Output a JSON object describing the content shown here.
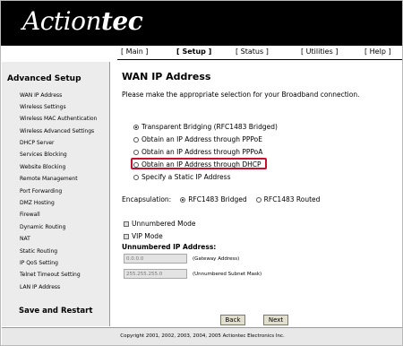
{
  "brand": {
    "logo_main": "Action",
    "logo_tec": "tec"
  },
  "nav": {
    "main": "[ Main ]",
    "setup": "[ Setup ]",
    "status": "[ Status ]",
    "utilities": "[ Utilities ]",
    "help": "[ Help ]"
  },
  "sidebar": {
    "title": "Advanced Setup",
    "items": [
      "WAN IP Address",
      "Wireless Settings",
      "Wireless MAC Authentication",
      "Wireless Advanced Settings",
      "DHCP Server",
      "Services Blocking",
      "Website Blocking",
      "Remote Management",
      "Port Forwarding",
      "DMZ Hosting",
      "Firewall",
      "Dynamic Routing",
      "NAT",
      "Static Routing",
      "IP QoS Setting",
      "Telnet Timeout Setting",
      "LAN IP Address"
    ],
    "save": "Save and Restart"
  },
  "main": {
    "title": "WAN IP Address",
    "intro": "Please make the appropriate selection for your Broadband connection.",
    "options": [
      "Transparent Bridging (RFC1483 Bridged)",
      "Obtain an IP Address through PPPoE",
      "Obtain an IP Address through PPPoA",
      "Obtain an IP Address through DHCP",
      "Specify a Static IP Address"
    ],
    "selected_option": 0,
    "highlight_color": "#c8102e",
    "encapsulation": {
      "label": "Encapsulation:",
      "bridged": "RFC1483 Bridged",
      "routed": "RFC1483 Routed"
    },
    "unnumbered_mode": "Unnumbered Mode",
    "vip_mode": "VIP Mode",
    "unnumbered_title": "Unnumbered IP Address:",
    "gateway_value": "0.0.0.0",
    "gateway_label": "(Gateway Address)",
    "mask_value": "255.255.255.0",
    "mask_label": "(Unnumbered Subnet Mask)",
    "back": "Back",
    "next": "Next"
  },
  "footer": "Copyright 2001, 2002, 2003, 2004, 2005 Actiontec Electronics Inc."
}
